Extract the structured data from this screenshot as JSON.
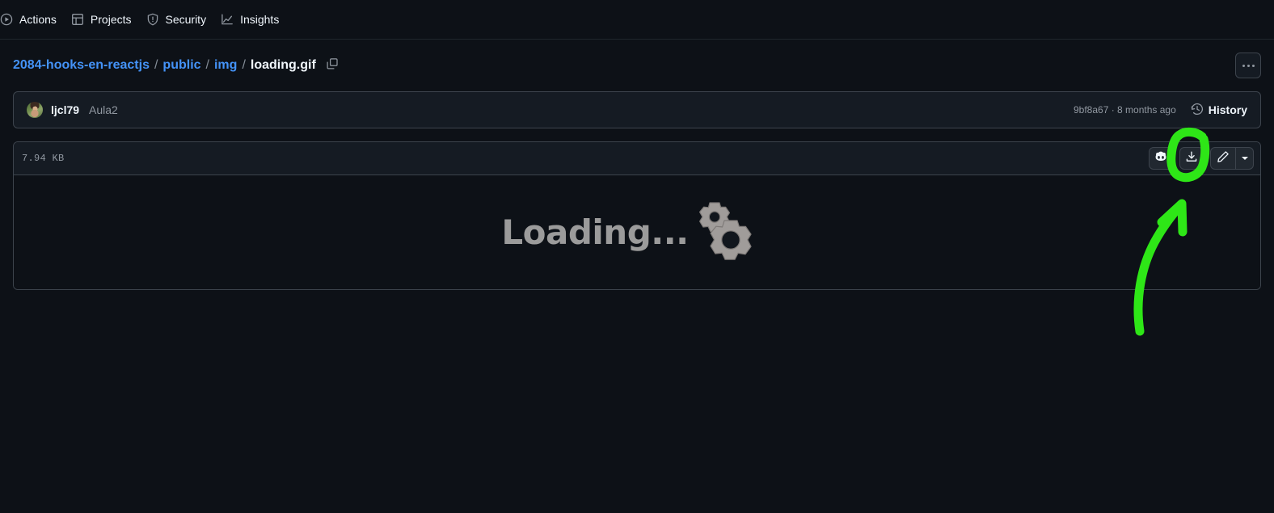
{
  "colors": {
    "page_bg": "#0d1117",
    "panel_bg": "#151b23",
    "border": "#3d444d",
    "link_blue": "#4493f8",
    "text_primary": "#f0f6fc",
    "text_muted": "#9198a1",
    "annotation_green": "#2ee617"
  },
  "repo_nav": {
    "items": [
      {
        "label": "Actions",
        "icon": "play-circle-icon"
      },
      {
        "label": "Projects",
        "icon": "table-icon"
      },
      {
        "label": "Security",
        "icon": "shield-icon"
      },
      {
        "label": "Insights",
        "icon": "graph-icon"
      }
    ]
  },
  "breadcrumb": {
    "repo": "2084-hooks-en-reactjs",
    "separator": "/",
    "folders": [
      "public",
      "img"
    ],
    "file": "loading.gif",
    "copy_icon": "copy-icon",
    "more_button_icon": "kebab-horizontal-icon"
  },
  "commit": {
    "avatar_alt": "ljcl79",
    "author": "ljcl79",
    "message": "Aula2",
    "hash": "9bf8a67",
    "separator": "·",
    "relative_time": "8 months ago",
    "meta": "9bf8a67 · 8 months ago",
    "history_label": "History",
    "history_icon": "history-clock-icon"
  },
  "file": {
    "size": "7.94 KB",
    "actions": [
      {
        "name": "copilot-button",
        "icon": "copilot-icon"
      },
      {
        "name": "download-button",
        "icon": "download-icon"
      },
      {
        "name": "edit-button",
        "icon": "pencil-icon"
      },
      {
        "name": "edit-dropdown-button",
        "icon": "chevron-down-icon"
      }
    ],
    "preview": {
      "type": "gif-image",
      "text": "Loading...",
      "graphic": "two-gears"
    }
  },
  "annotation": {
    "type": "hand-drawn-highlight",
    "shapes": [
      "circle-around-download-button",
      "upward-curved-arrow"
    ],
    "color": "#2ee617"
  }
}
